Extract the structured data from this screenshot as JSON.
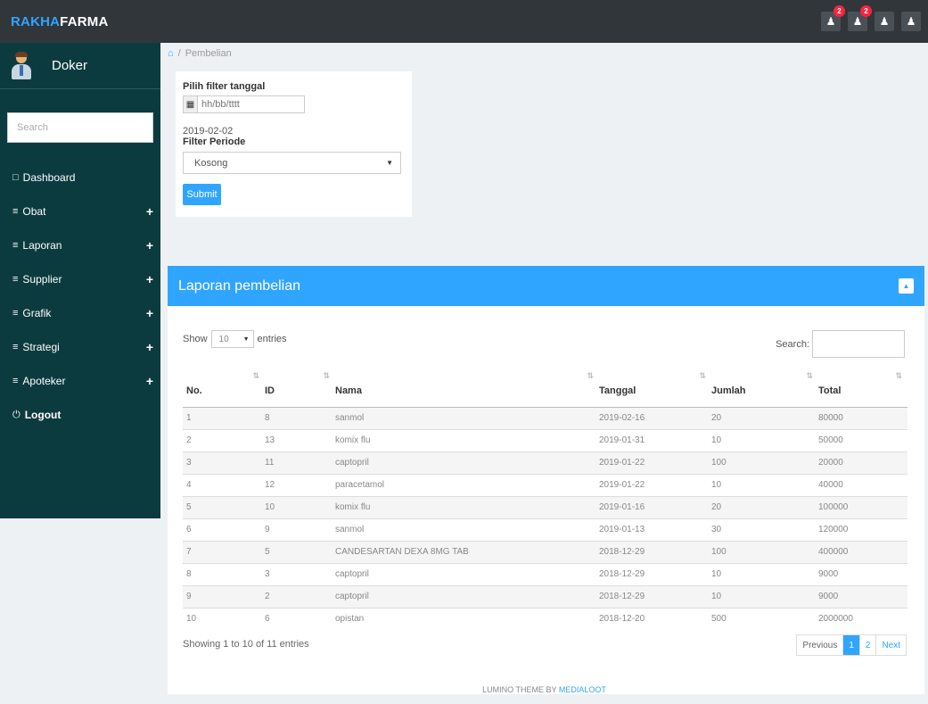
{
  "header": {
    "brand_part1": "RAKHA",
    "brand_part2": "FARMA",
    "badge_1": "2",
    "badge_2": "2",
    "icon_names": [
      "user-icon",
      "user-icon",
      "user-icon",
      "user-icon"
    ]
  },
  "sidebar": {
    "user_name": "Doker",
    "search_placeholder": "Search",
    "items": [
      {
        "label": "Dashboard"
      },
      {
        "label": "Obat"
      },
      {
        "label": "Laporan"
      },
      {
        "label": "Supplier"
      },
      {
        "label": "Grafik"
      },
      {
        "label": "Strategi"
      },
      {
        "label": "Apoteker"
      },
      {
        "label": "Logout"
      }
    ]
  },
  "breadcrumb": {
    "current": "Pembelian"
  },
  "filter": {
    "date_label": "Pilih filter tanggal",
    "date_placeholder": "hh/bb/tttt",
    "selected_date": "2019-02-02",
    "period_label": "Filter Periode",
    "period_value": "Kosong",
    "submit_label": "Submit"
  },
  "report": {
    "title": "Laporan pembelian",
    "show_label": "Show",
    "entries_value": "10",
    "entries_label": "entries",
    "search_label": "Search:",
    "columns": [
      "No.",
      "ID",
      "Nama",
      "Tanggal",
      "Jumlah",
      "Total"
    ],
    "rows": [
      {
        "no": "1",
        "id": "8",
        "nama": "sanmol",
        "tanggal": "2019-02-16",
        "jumlah": "20",
        "total": "80000"
      },
      {
        "no": "2",
        "id": "13",
        "nama": "komix flu",
        "tanggal": "2019-01-31",
        "jumlah": "10",
        "total": "50000"
      },
      {
        "no": "3",
        "id": "11",
        "nama": "captopril",
        "tanggal": "2019-01-22",
        "jumlah": "100",
        "total": "20000"
      },
      {
        "no": "4",
        "id": "12",
        "nama": "paracetamol",
        "tanggal": "2019-01-22",
        "jumlah": "10",
        "total": "40000"
      },
      {
        "no": "5",
        "id": "10",
        "nama": "komix flu",
        "tanggal": "2019-01-16",
        "jumlah": "20",
        "total": "100000"
      },
      {
        "no": "6",
        "id": "9",
        "nama": "sanmol",
        "tanggal": "2019-01-13",
        "jumlah": "30",
        "total": "120000"
      },
      {
        "no": "7",
        "id": "5",
        "nama": "CANDESARTAN DEXA 8MG TAB",
        "tanggal": "2018-12-29",
        "jumlah": "100",
        "total": "400000"
      },
      {
        "no": "8",
        "id": "3",
        "nama": "captopril",
        "tanggal": "2018-12-29",
        "jumlah": "10",
        "total": "9000"
      },
      {
        "no": "9",
        "id": "2",
        "nama": "captopril",
        "tanggal": "2018-12-29",
        "jumlah": "10",
        "total": "9000"
      },
      {
        "no": "10",
        "id": "6",
        "nama": "opistan",
        "tanggal": "2018-12-20",
        "jumlah": "500",
        "total": "2000000"
      }
    ],
    "info": "Showing 1 to 10 of 11 entries",
    "pagination": {
      "previous": "Previous",
      "page_1": "1",
      "page_2": "2",
      "next": "Next"
    }
  },
  "footer": {
    "text": "LUMINO THEME BY ",
    "link": "MEDIALOOT"
  },
  "colors": {
    "topbar": "#30363a",
    "sidebar": "#0c3b3f",
    "accent": "#30a5ff",
    "badge": "#f9243f"
  }
}
